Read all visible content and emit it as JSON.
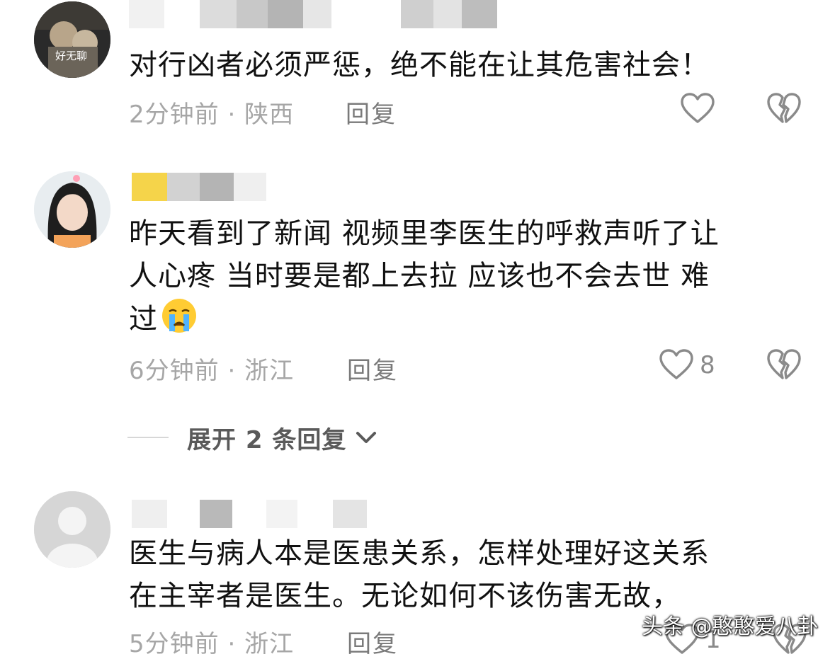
{
  "comments": [
    {
      "avatar_label": "好无聊",
      "text": "对行凶者必须严惩，绝不能在让其危害社会！",
      "time": "2分钟前",
      "location": "陕西",
      "reply_label": "回复",
      "like_count": ""
    },
    {
      "text_line1": "昨天看到了新闻  视频里李医生的呼救声听了让",
      "text_line2": "人心疼  当时要是都上去拉 应该也不会去世 难",
      "text_line3": "过",
      "time": "6分钟前",
      "location": "浙江",
      "reply_label": "回复",
      "like_count": "8",
      "expand_label": "展开 2 条回复"
    },
    {
      "text_line1": "医生与病人本是医患关系，怎样处理好这关系",
      "text_line2": "在主宰者是医生。无论如何不该伤害无故，",
      "time": "5分钟前",
      "location": "浙江",
      "reply_label": "回复",
      "like_count": "1"
    }
  ],
  "separator": "·",
  "watermark": "头条 @憨憨爱八卦",
  "colors": {
    "text": "#111111",
    "meta": "#a6a6a6",
    "icon": "#8a8a8a"
  }
}
